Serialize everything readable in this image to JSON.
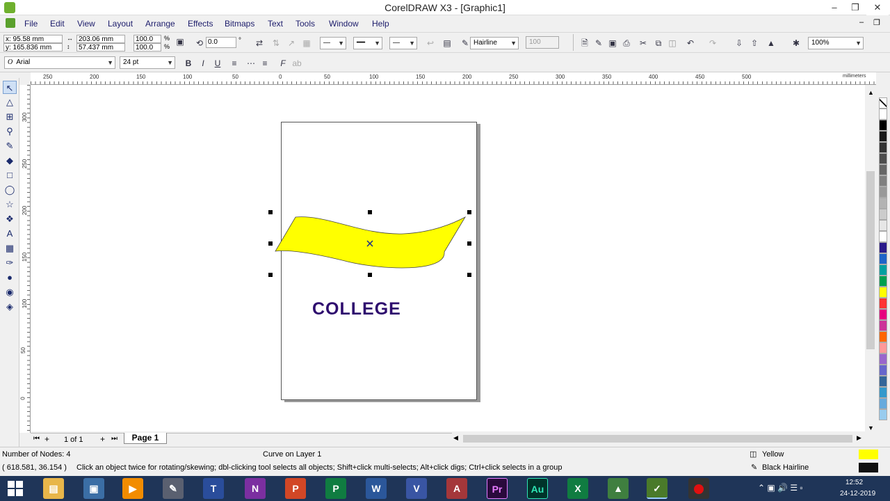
{
  "window": {
    "title": "CorelDRAW X3 - [Graphic1]",
    "min": "–",
    "restore": "❐",
    "close": "✕",
    "doc_min": "–",
    "doc_restore": "❐"
  },
  "menu": [
    "File",
    "Edit",
    "View",
    "Layout",
    "Arrange",
    "Effects",
    "Bitmaps",
    "Text",
    "Tools",
    "Window",
    "Help"
  ],
  "props": {
    "x": "x: 95.58 mm",
    "y": "y: 165.836 mm",
    "w": "203.06 mm",
    "h": "57.437 mm",
    "scale_w": "100.0",
    "scale_h": "100.0",
    "pct": "%",
    "angle": "0.0",
    "outline": "Hairline",
    "outline_val": "100",
    "zoom": "100%"
  },
  "text_toolbar": {
    "font": "Arial",
    "size": "24 pt",
    "bold": "B",
    "italic": "I",
    "underline": "U"
  },
  "ruler": {
    "unit": "millimeters",
    "h_ticks": [
      "250",
      "200",
      "150",
      "100",
      "50",
      "0",
      "50",
      "100",
      "150",
      "200",
      "250",
      "300",
      "350",
      "400",
      "450",
      "500"
    ],
    "v_ticks": [
      "300",
      "250",
      "200",
      "150",
      "100",
      "50",
      "0"
    ]
  },
  "doc": {
    "text": "COLLEGE",
    "text_color": "#2e0c6e",
    "shape_fill": "#ffff00"
  },
  "pages": {
    "count": "1 of 1",
    "tab": "Page 1"
  },
  "status": {
    "nodes": "Number of Nodes: 4",
    "object": "Curve on Layer 1",
    "coords": "( 618.581, 36.154 )",
    "hint": "Click an object twice for rotating/skewing; dbl-clicking tool selects all objects; Shift+click multi-selects; Alt+click digs; Ctrl+click selects in a group",
    "fill": "Yellow",
    "outline": "Black  Hairline"
  },
  "palette": [
    "#ffffff",
    "#000000",
    "#1a1a1a",
    "#333333",
    "#4d4d4d",
    "#666666",
    "#808080",
    "#999999",
    "#b3b3b3",
    "#cccccc",
    "#e6e6e6",
    "#ffffff",
    "#2a1a8a",
    "#1e64c8",
    "#00a0a0",
    "#00a050",
    "#ffff00",
    "#ff3333",
    "#e6007e",
    "#cc3399",
    "#ff6600",
    "#ff9999",
    "#9966cc",
    "#6666cc",
    "#336699",
    "#3399cc",
    "#66aadd",
    "#99ccee"
  ],
  "taskbar": {
    "time": "12:52",
    "date": "24-12-2019"
  }
}
